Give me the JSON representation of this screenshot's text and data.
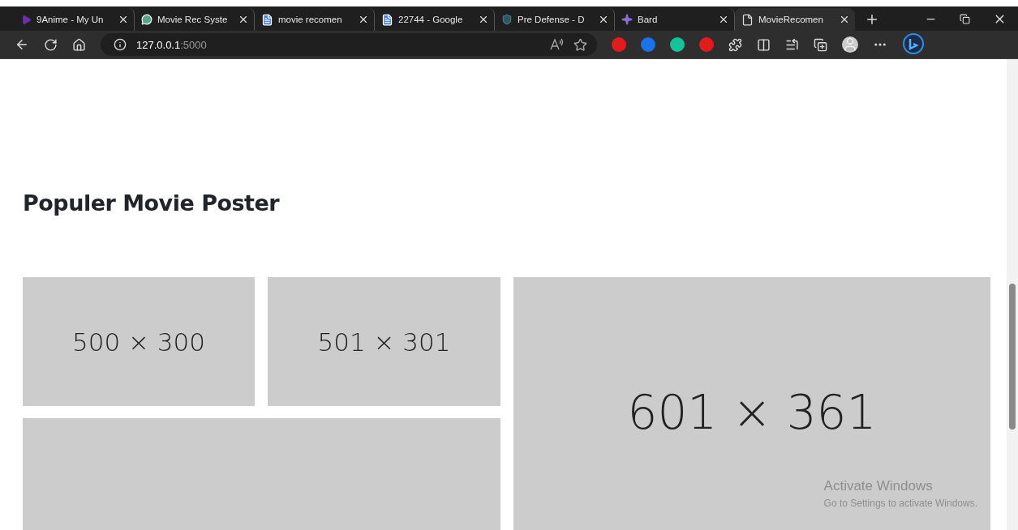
{
  "tabs": [
    {
      "title": "9Anime - My Un",
      "selected": false
    },
    {
      "title": "Movie Rec Syste",
      "selected": false
    },
    {
      "title": "movie recomen",
      "selected": false
    },
    {
      "title": "22744 - Google",
      "selected": false
    },
    {
      "title": "Pre Defense - D",
      "selected": false
    },
    {
      "title": "Bard",
      "selected": false
    },
    {
      "title": "MovieRecomen",
      "selected": true
    }
  ],
  "address": {
    "host": "127.0.0.1",
    "port": ":5000"
  },
  "page": {
    "heading": "Populer Movie Poster",
    "tiles": [
      {
        "label": "500 × 300"
      },
      {
        "label": "501 × 301"
      },
      {
        "label": "601 × 361"
      }
    ]
  },
  "activation_notice": {
    "title": "Activate Windows",
    "subtitle": "Go to Settings to activate Windows."
  }
}
